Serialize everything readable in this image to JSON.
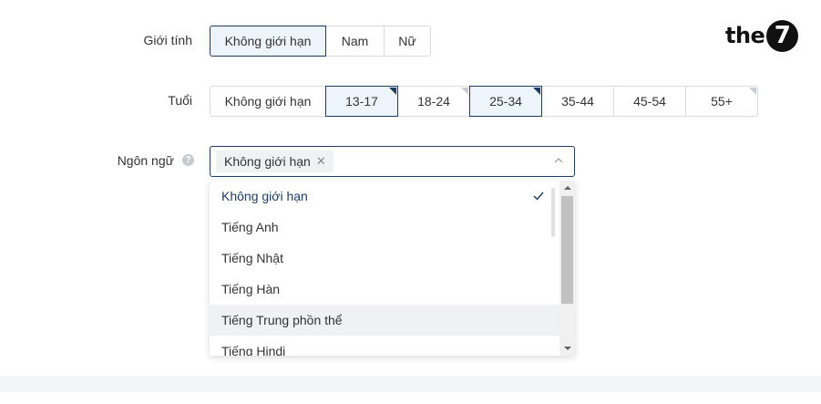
{
  "gender": {
    "label": "Giới tính",
    "options": [
      {
        "label": "Không giới hạn",
        "selected": true
      },
      {
        "label": "Nam",
        "selected": false
      },
      {
        "label": "Nữ",
        "selected": false
      }
    ]
  },
  "age": {
    "label": "Tuổi",
    "options": [
      {
        "label": "Không giới hạn",
        "selected": false
      },
      {
        "label": "13-17",
        "selected": true
      },
      {
        "label": "18-24",
        "selected": false
      },
      {
        "label": "25-34",
        "selected": true
      },
      {
        "label": "35-44",
        "selected": false
      },
      {
        "label": "45-54",
        "selected": false
      },
      {
        "label": "55+",
        "selected": false
      }
    ]
  },
  "language": {
    "label": "Ngôn ngữ",
    "help_icon": "question-circle-icon",
    "selected_tags": [
      {
        "label": "Không giới hạn",
        "remove_glyph": "✕"
      }
    ],
    "dropdown_items": [
      {
        "label": "Không giới hạn",
        "selected": true
      },
      {
        "label": "Tiếng Anh",
        "selected": false
      },
      {
        "label": "Tiếng Nhật",
        "selected": false
      },
      {
        "label": "Tiếng Hàn",
        "selected": false
      },
      {
        "label": "Tiếng Trung phồn thể",
        "selected": false,
        "hovered": true
      },
      {
        "label": "Tiếng Hindi",
        "selected": false
      }
    ]
  },
  "logo": {
    "text": "the",
    "badge": "7"
  },
  "colors": {
    "accent": "#1f3d63",
    "selected_bg": "#eef4fb",
    "border": "#d9dbdf",
    "hover_bg": "#eff1f4"
  }
}
